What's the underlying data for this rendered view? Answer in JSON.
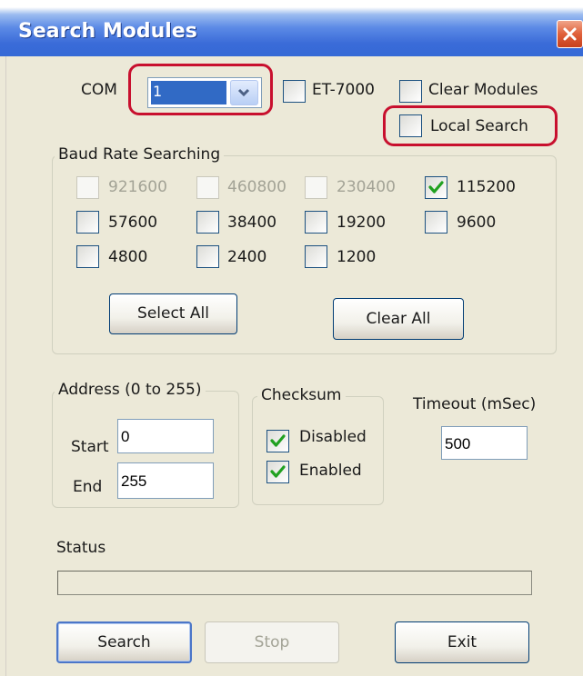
{
  "window": {
    "title": "Search Modules"
  },
  "com": {
    "label": "COM",
    "selected_value": "1"
  },
  "options": {
    "et7000": {
      "label": "ET-7000",
      "checked": false
    },
    "clear_modules": {
      "label": "Clear Modules",
      "checked": false
    },
    "local_search": {
      "label": "Local Search",
      "checked": false
    }
  },
  "baud_group": {
    "title": "Baud Rate Searching",
    "rates": [
      {
        "label": "921600",
        "checked": false,
        "enabled": false
      },
      {
        "label": "460800",
        "checked": false,
        "enabled": false
      },
      {
        "label": "230400",
        "checked": false,
        "enabled": false
      },
      {
        "label": "115200",
        "checked": true,
        "enabled": true
      },
      {
        "label": "57600",
        "checked": false,
        "enabled": true
      },
      {
        "label": "38400",
        "checked": false,
        "enabled": true
      },
      {
        "label": "19200",
        "checked": false,
        "enabled": true
      },
      {
        "label": "9600",
        "checked": false,
        "enabled": true
      },
      {
        "label": "4800",
        "checked": false,
        "enabled": true
      },
      {
        "label": "2400",
        "checked": false,
        "enabled": true
      },
      {
        "label": "1200",
        "checked": false,
        "enabled": true
      }
    ],
    "select_all_label": "Select All",
    "clear_all_label": "Clear All"
  },
  "address_group": {
    "title": "Address (0 to 255)",
    "start_label": "Start",
    "start_value": "0",
    "end_label": "End",
    "end_value": "255"
  },
  "checksum_group": {
    "title": "Checksum",
    "disabled_label": "Disabled",
    "disabled_checked": true,
    "enabled_label": "Enabled",
    "enabled_checked": true
  },
  "timeout": {
    "label": "Timeout (mSec)",
    "value": "500"
  },
  "status": {
    "label": "Status",
    "progress": 0
  },
  "buttons": {
    "search": "Search",
    "stop": "Stop",
    "exit": "Exit"
  },
  "colors": {
    "check": "#21a121",
    "titlebar": "#3a6bd8",
    "highlight": "#c8102e"
  }
}
